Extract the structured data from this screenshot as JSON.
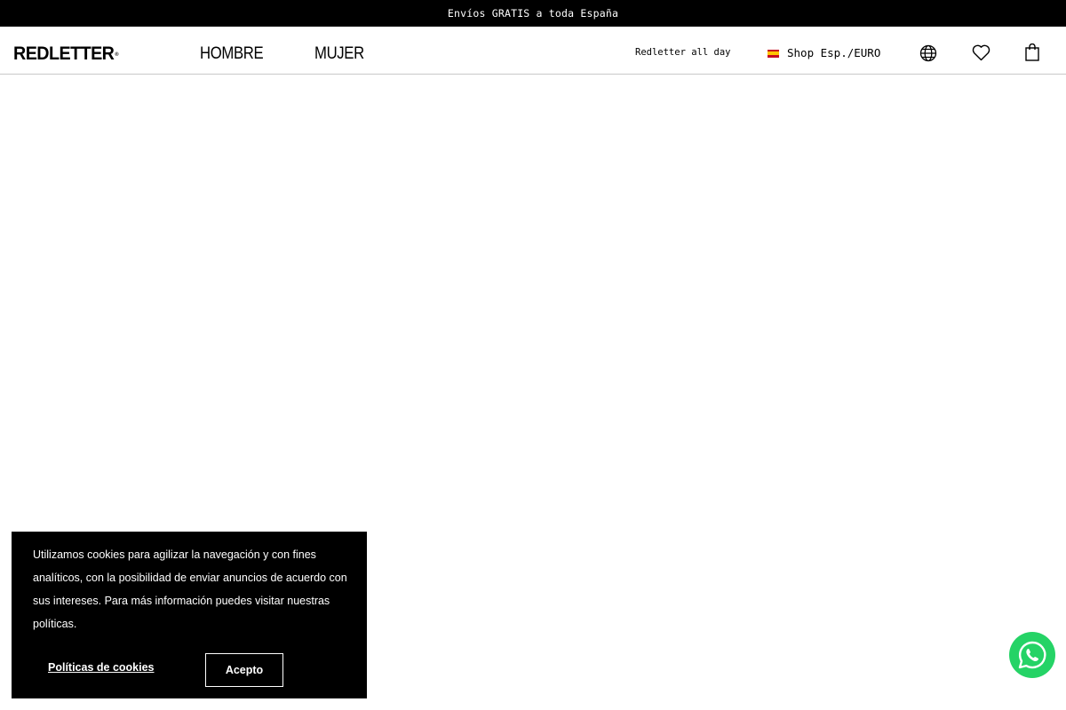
{
  "promo": {
    "text": "Envíos GRATIS a toda España"
  },
  "header": {
    "logo": "REDLETTER",
    "logo_mark": "®",
    "nav": [
      {
        "label": "HOMBRE"
      },
      {
        "label": "MUJER"
      }
    ],
    "tagline": "Redletter all day",
    "shop": {
      "label": "Shop Esp./EURO",
      "flag_icon": "spain-flag-icon"
    },
    "icons": [
      "globe-icon",
      "heart-icon",
      "shopping-bag-icon"
    ]
  },
  "cookie_banner": {
    "text": "Utilizamos cookies para agilizar la navegación y con fines analíticos, con la posibilidad de enviar anuncios de acuerdo con sus intereses. Para más información puedes visitar nuestras políticas.",
    "policy_link": "Políticas de cookies",
    "accept_label": "Acepto"
  },
  "floating": {
    "icon": "whatsapp-icon",
    "color": "#25d366"
  },
  "colors": {
    "bar": "#000000",
    "background": "#ffffff",
    "whatsapp": "#25d366"
  }
}
